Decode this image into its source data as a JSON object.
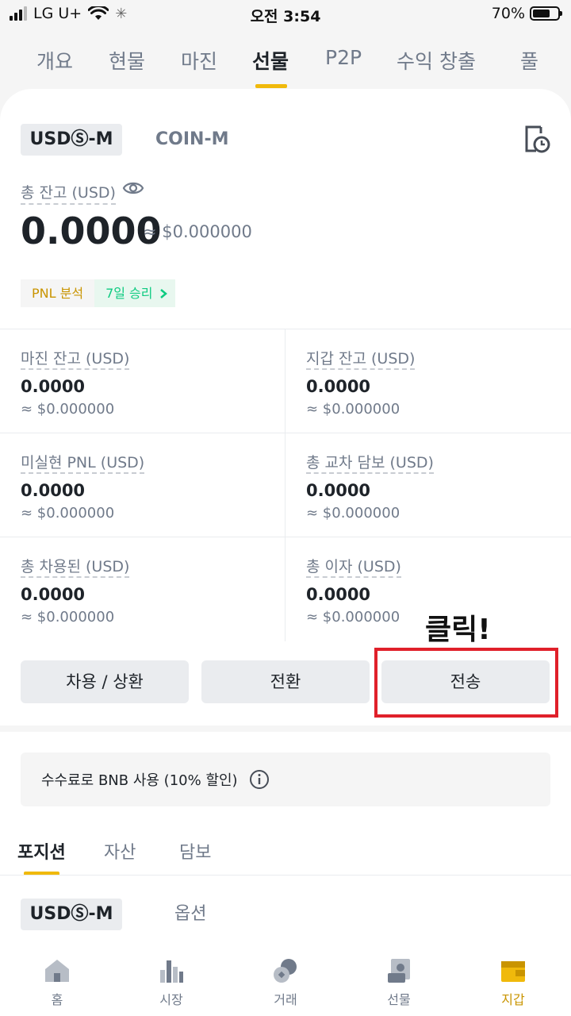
{
  "status_bar": {
    "carrier": "LG U+",
    "time": "오전 3:54",
    "battery": "70%"
  },
  "top_tabs": [
    "개요",
    "현물",
    "마진",
    "선물",
    "P2P",
    "수익 창출",
    "풀"
  ],
  "top_tab_active": "선물",
  "segment": {
    "active": "USDⓈ-M",
    "inactive": "COIN-M"
  },
  "balance": {
    "label": "총 잔고 (USD)",
    "value": "0.0000",
    "approx": "≈ $0.000000"
  },
  "pnl": {
    "left": "PNL 분석",
    "right": "7일 승리"
  },
  "stats": [
    {
      "label": "마진 잔고 (USD)",
      "value": "0.0000",
      "approx": "≈ $0.000000"
    },
    {
      "label": "지갑 잔고 (USD)",
      "value": "0.0000",
      "approx": "≈ $0.000000"
    },
    {
      "label": "미실현 PNL (USD)",
      "value": "0.0000",
      "approx": "≈ $0.000000"
    },
    {
      "label": "총 교차 담보 (USD)",
      "value": "0.0000",
      "approx": "≈ $0.000000"
    },
    {
      "label": "총 차용된 (USD)",
      "value": "0.0000",
      "approx": "≈ $0.000000"
    },
    {
      "label": "총 이자 (USD)",
      "value": "0.0000",
      "approx": "≈ $0.000000"
    }
  ],
  "annotation": "클릭!",
  "actions": {
    "borrow": "차용 / 상환",
    "convert": "전환",
    "transfer": "전송"
  },
  "bnb_fee": "수수료로 BNB 사용 (10% 할인)",
  "sub_tabs": [
    "포지션",
    "자산",
    "담보"
  ],
  "sub_tab_active": "포지션",
  "segment2": {
    "active": "USDⓈ-M",
    "inactive": "옵션"
  },
  "bottom_nav": [
    "홈",
    "시장",
    "거래",
    "선물",
    "지갑"
  ],
  "bottom_nav_active": "지갑",
  "colors": {
    "accent": "#f0b90b",
    "text_primary": "#1e2329",
    "text_secondary": "#707a8a",
    "success": "#0ecb81",
    "annotation_box": "#e0202a"
  }
}
